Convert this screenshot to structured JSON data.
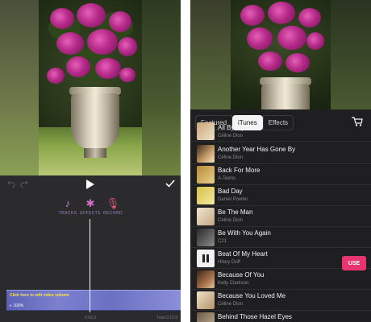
{
  "editor": {
    "tools": [
      {
        "label": "TRACKS",
        "icon": "music-note-icon"
      },
      {
        "label": "EFFECTS",
        "icon": "sparkle-icon"
      },
      {
        "label": "RECORD",
        "icon": "microphone-icon"
      }
    ],
    "clip_hint": "Click here to edit video volume",
    "clip_volume": "100%",
    "time_current": "0:00.3",
    "time_total": "Total 0:15.5",
    "accent_color": "#9a86b8"
  },
  "browser": {
    "tabs": [
      "Featured",
      "iTunes",
      "Effects"
    ],
    "active_tab": "iTunes",
    "songs": [
      {
        "title": "All By Myself",
        "artist": "Céline Dion"
      },
      {
        "title": "Another Year Has Gone By",
        "artist": "Céline Dion"
      },
      {
        "title": "Back For More",
        "artist": "A-Teens"
      },
      {
        "title": "Bad Day",
        "artist": "Daniel Powter"
      },
      {
        "title": "Be The Man",
        "artist": "Céline Dion"
      },
      {
        "title": "Be With You Again",
        "artist": "C21"
      },
      {
        "title": "Beat Of My Heart",
        "artist": "Hilary Duff"
      },
      {
        "title": "Because Of You",
        "artist": "Kelly Clarkson"
      },
      {
        "title": "Because You Loved Me",
        "artist": "Céline Dion"
      },
      {
        "title": "Behind Those Hazel Eyes",
        "artist": ""
      }
    ],
    "use_label": "USE",
    "use_color": "#e8346f"
  }
}
